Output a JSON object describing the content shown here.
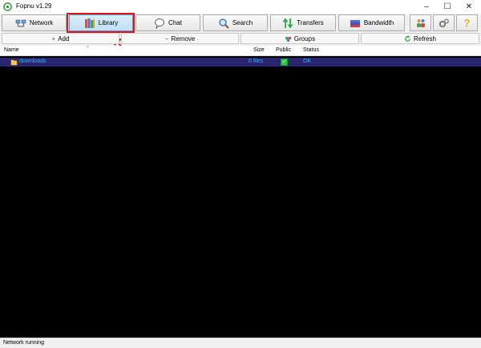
{
  "window": {
    "title": "Fopnu v1.29",
    "minimize": "–",
    "maximize": "☐",
    "close": "✕"
  },
  "toolbar": {
    "network": "Network",
    "library": "Library",
    "chat": "Chat",
    "search": "Search",
    "transfers": "Transfers",
    "bandwidth": "Bandwidth",
    "help": "?"
  },
  "actions": {
    "add": "Add",
    "remove": "Remove",
    "groups": "Groups",
    "refresh": "Refresh"
  },
  "columns": {
    "name": "Name",
    "size": "Size",
    "public": "Public",
    "status": "Status"
  },
  "rows": [
    {
      "name": "downloads",
      "size": "0 files",
      "public": "✓",
      "status": "OK"
    }
  ],
  "statusbar": {
    "text": "Network running"
  },
  "colors": {
    "highlight": "#e3141b",
    "row_bg": "#2a2570",
    "row_text": "#35b6ec",
    "list_bg": "#000000"
  }
}
